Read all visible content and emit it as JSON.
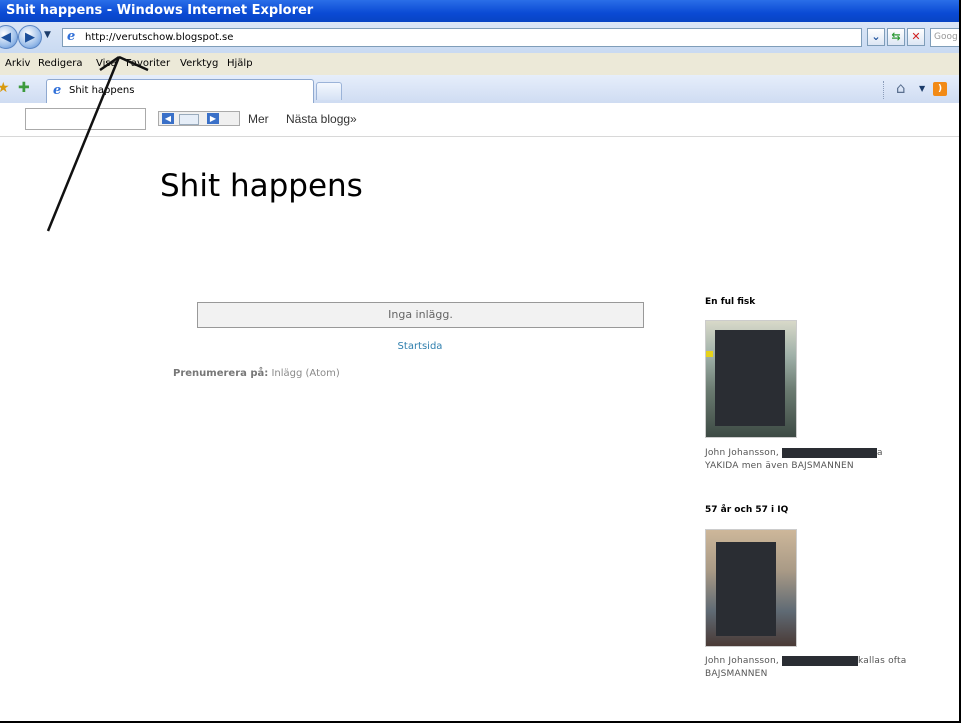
{
  "window": {
    "title": "Shit happens - Windows Internet Explorer"
  },
  "address_bar": {
    "url": "http://verutschow.blogspot.se",
    "search_placeholder": "Goog"
  },
  "menu": [
    "Arkiv",
    "Redigera",
    "Visa",
    "Favoriter",
    "Verktyg",
    "Hjälp"
  ],
  "tabs": [
    {
      "label": "Shit happens",
      "active": true
    }
  ],
  "blogger_navbar": {
    "more_label": "Mer",
    "next_blog_label": "Nästa blogg»"
  },
  "blog": {
    "title": "Shit happens"
  },
  "main": {
    "status": "Inga inlägg.",
    "home_link": "Startsida",
    "subscribe_prefix": "Prenumerera på:",
    "subscribe_link": "Inlägg (Atom)"
  },
  "sidebar": {
    "profiles": [
      {
        "title": "En ful fisk",
        "text_start": "John Johansson,",
        "text_after_redaction": "a",
        "text_line2": "YAKIDA men även BAJSMANNEN"
      },
      {
        "title": "57 år och 57 i IQ",
        "text_start": "John Johansson,",
        "text_after_redaction": "kallas ofta",
        "text_line2": "BAJSMANNEN"
      }
    ]
  },
  "colors": {
    "title_bar": "#0a4ad4",
    "link": "#2f7fae",
    "redaction": "#2a2d33"
  }
}
